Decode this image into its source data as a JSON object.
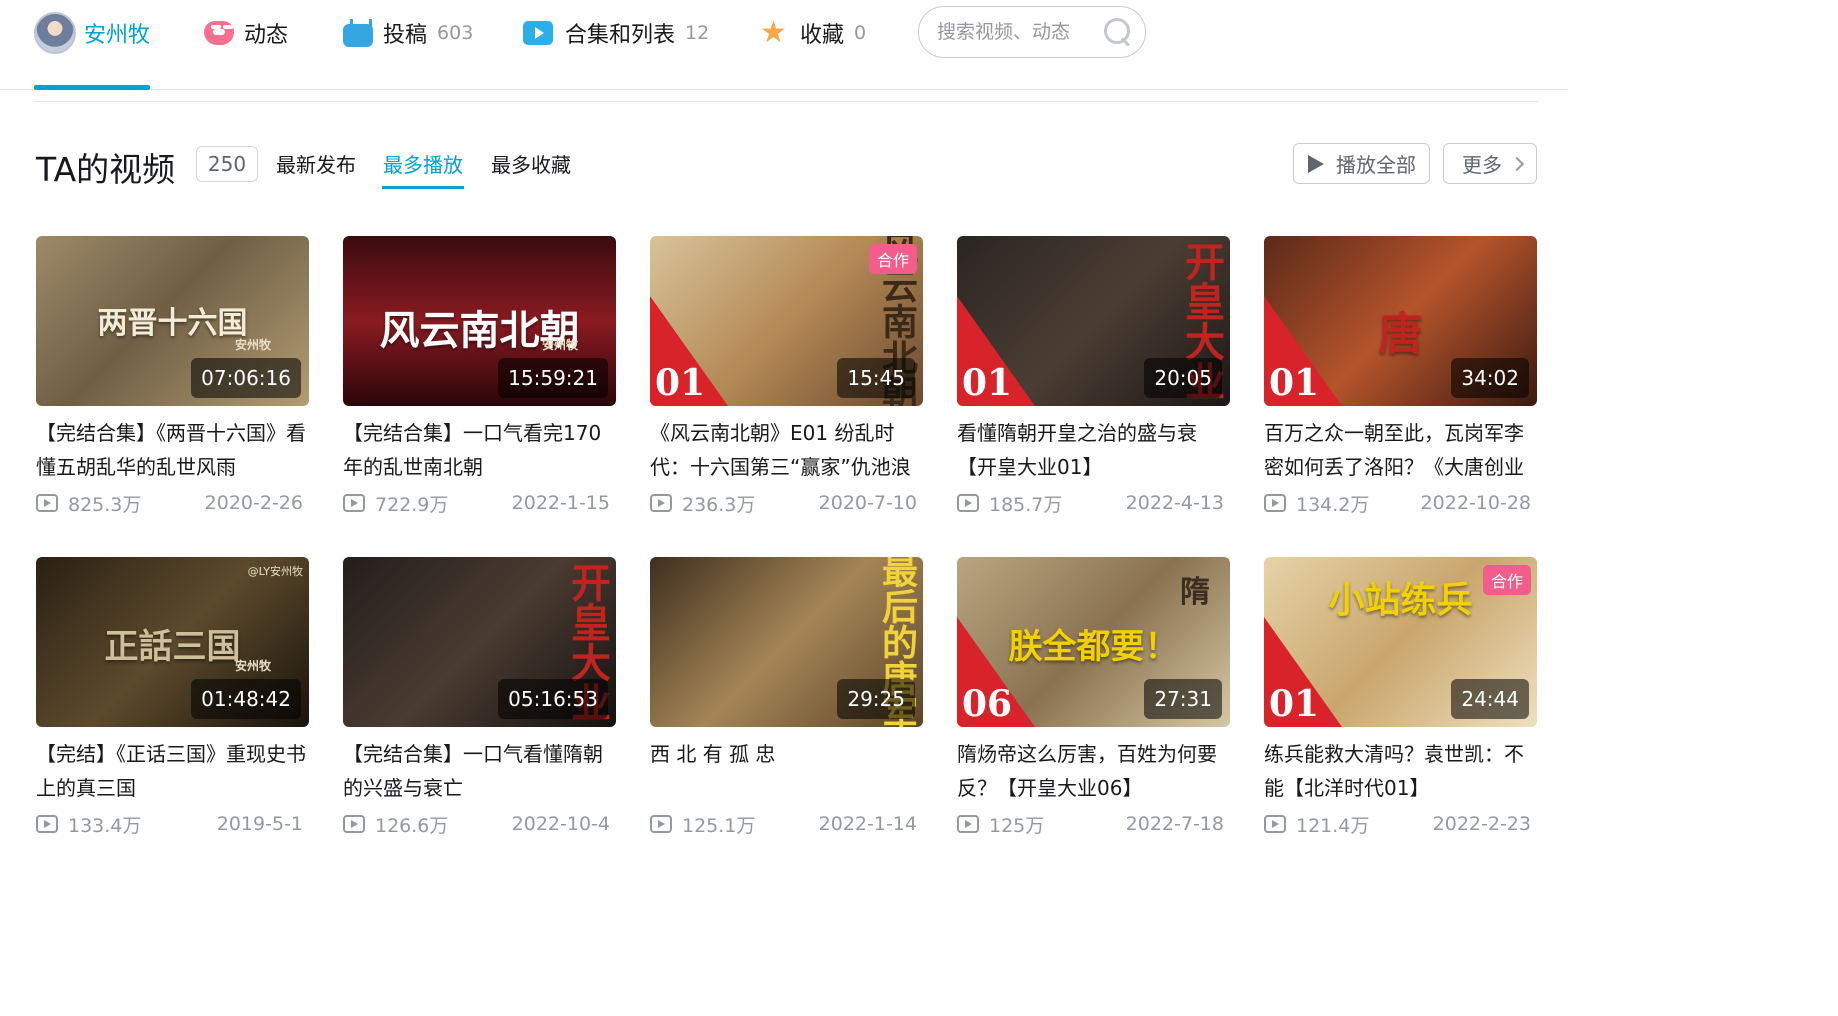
{
  "nav": {
    "home_label": "安州牧",
    "dynamic_label": "动态",
    "uploads_label": "投稿",
    "uploads_count": "603",
    "collections_label": "合集和列表",
    "collections_count": "12",
    "favorites_label": "收藏",
    "favorites_count": "0",
    "search_placeholder": "搜索视频、动态"
  },
  "section": {
    "title": "TA的视频",
    "count": "250",
    "sorts": [
      "最新发布",
      "最多播放",
      "最多收藏"
    ],
    "active_sort": "最多播放",
    "play_all_label": "播放全部",
    "more_label": "更多"
  },
  "videos": [
    {
      "thumb_text": "两晋十六国",
      "thumb_sub": "安州牧",
      "duration": "07:06:16",
      "title": "【完结合集】《两晋十六国》看懂五胡乱华的乱世风雨",
      "plays": "825.3万",
      "date": "2020-2-26"
    },
    {
      "thumb_text": "风云南北朝",
      "thumb_sub": "安州牧",
      "duration": "15:59:21",
      "title": "【完结合集】一口气看完170年的乱世南北朝",
      "plays": "722.9万",
      "date": "2022-1-15"
    },
    {
      "thumb_text": "风云南北朝",
      "ribbon": "01",
      "badge": "合作",
      "duration": "15:45",
      "title": "《风云南北朝》E01 纷乱时代：十六国第三“赢家”仇池浪",
      "plays": "236.3万",
      "date": "2020-7-10"
    },
    {
      "thumb_text": "开皇大业",
      "ribbon": "01",
      "duration": "20:05",
      "title": "看懂隋朝开皇之治的盛与衰【开皇大业01】",
      "plays": "185.7万",
      "date": "2022-4-13"
    },
    {
      "thumb_text": "唐",
      "ribbon": "01",
      "duration": "34:02",
      "title": "百万之众一朝至此，瓦岗军李密如何丢了洛阳？《大唐创业",
      "plays": "134.2万",
      "date": "2022-10-28"
    },
    {
      "thumb_text": "正話三国",
      "thumb_sub": "安州牧",
      "watermark": "@LY安州牧",
      "duration": "01:48:42",
      "title": "【完结】《正话三国》重现史书上的真三国",
      "plays": "133.4万",
      "date": "2019-5-1"
    },
    {
      "thumb_text": "开皇大业",
      "duration": "05:16:53",
      "title": "【完结合集】一口气看懂隋朝的兴盛与衰亡",
      "plays": "126.6万",
      "date": "2022-10-4"
    },
    {
      "thumb_text": "最后的唐军",
      "duration": "29:25",
      "title": "西 北 有 孤 忠",
      "plays": "125.1万",
      "date": "2022-1-14"
    },
    {
      "thumb_text": "朕全都要！",
      "thumb_sub": "隋",
      "ribbon": "06",
      "duration": "27:31",
      "title": "隋炀帝这么厉害，百姓为何要反？【开皇大业06】",
      "plays": "125万",
      "date": "2022-7-18"
    },
    {
      "thumb_text": "小站练兵",
      "ribbon": "01",
      "badge": "合作",
      "duration": "24:44",
      "title": "练兵能救大清吗？袁世凯：不能【北洋时代01】",
      "plays": "121.4万",
      "date": "2022-2-23"
    }
  ]
}
